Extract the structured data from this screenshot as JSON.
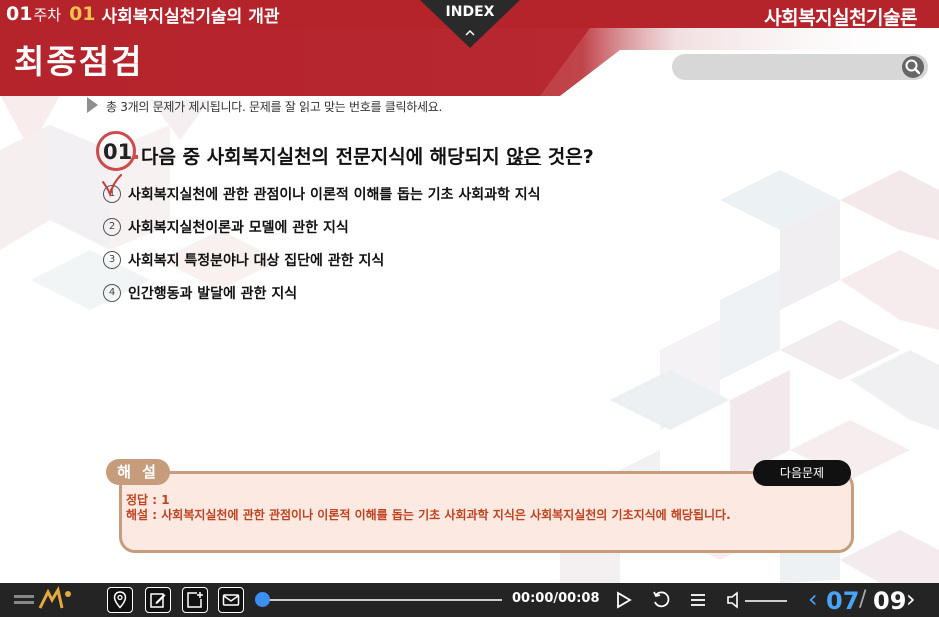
{
  "header": {
    "week_num": "01",
    "week_label": "주차",
    "chapter_num": "01",
    "chapter_title": "사회복지실천기술의 개관",
    "course_name": "사회복지실천기술론",
    "index_label": "INDEX"
  },
  "title": "최종점검",
  "search": {
    "placeholder": "",
    "icon": "search-icon"
  },
  "instruction": "총 3개의 문제가 제시됩니다. 문제를 잘 읽고 맞는 번호를 클릭하세요.",
  "question": {
    "number": "01",
    "text_before": "다음 중 사회복지실천의 전문지식에 해당되지 ",
    "text_underlined": "않은",
    "text_after": " 것은?",
    "selected_option": 1,
    "options": [
      {
        "num": "1",
        "text": "사회복지실천에 관한 관점이나 이론적 이해를 돕는 기초 사회과학 지식"
      },
      {
        "num": "2",
        "text": "사회복지실천이론과 모델에 관한 지식"
      },
      {
        "num": "3",
        "text": "사회복지 특정분야나 대상 집단에 관한 지식"
      },
      {
        "num": "4",
        "text": "인간행동과 발달에 관한 지식"
      }
    ]
  },
  "explanation": {
    "tab_label": "해 설",
    "next_label": "다음문제",
    "answer": "정답 : 1",
    "text": "해설 : 사회복지실천에 관한 관점이나 이론적 이해를 돕는 기초 사회과학 지식은 사회복지실천의 기초지식에 해당됩니다."
  },
  "player": {
    "time": "00:00/00:08",
    "progress": 0,
    "current_page": "07",
    "page_separator": "/",
    "total_pages": "09"
  },
  "colors": {
    "brand_red": "#b5232b",
    "accent_tan": "#c69c7c",
    "answer_text": "#c2421f",
    "player_blue": "#4aa3f5"
  }
}
